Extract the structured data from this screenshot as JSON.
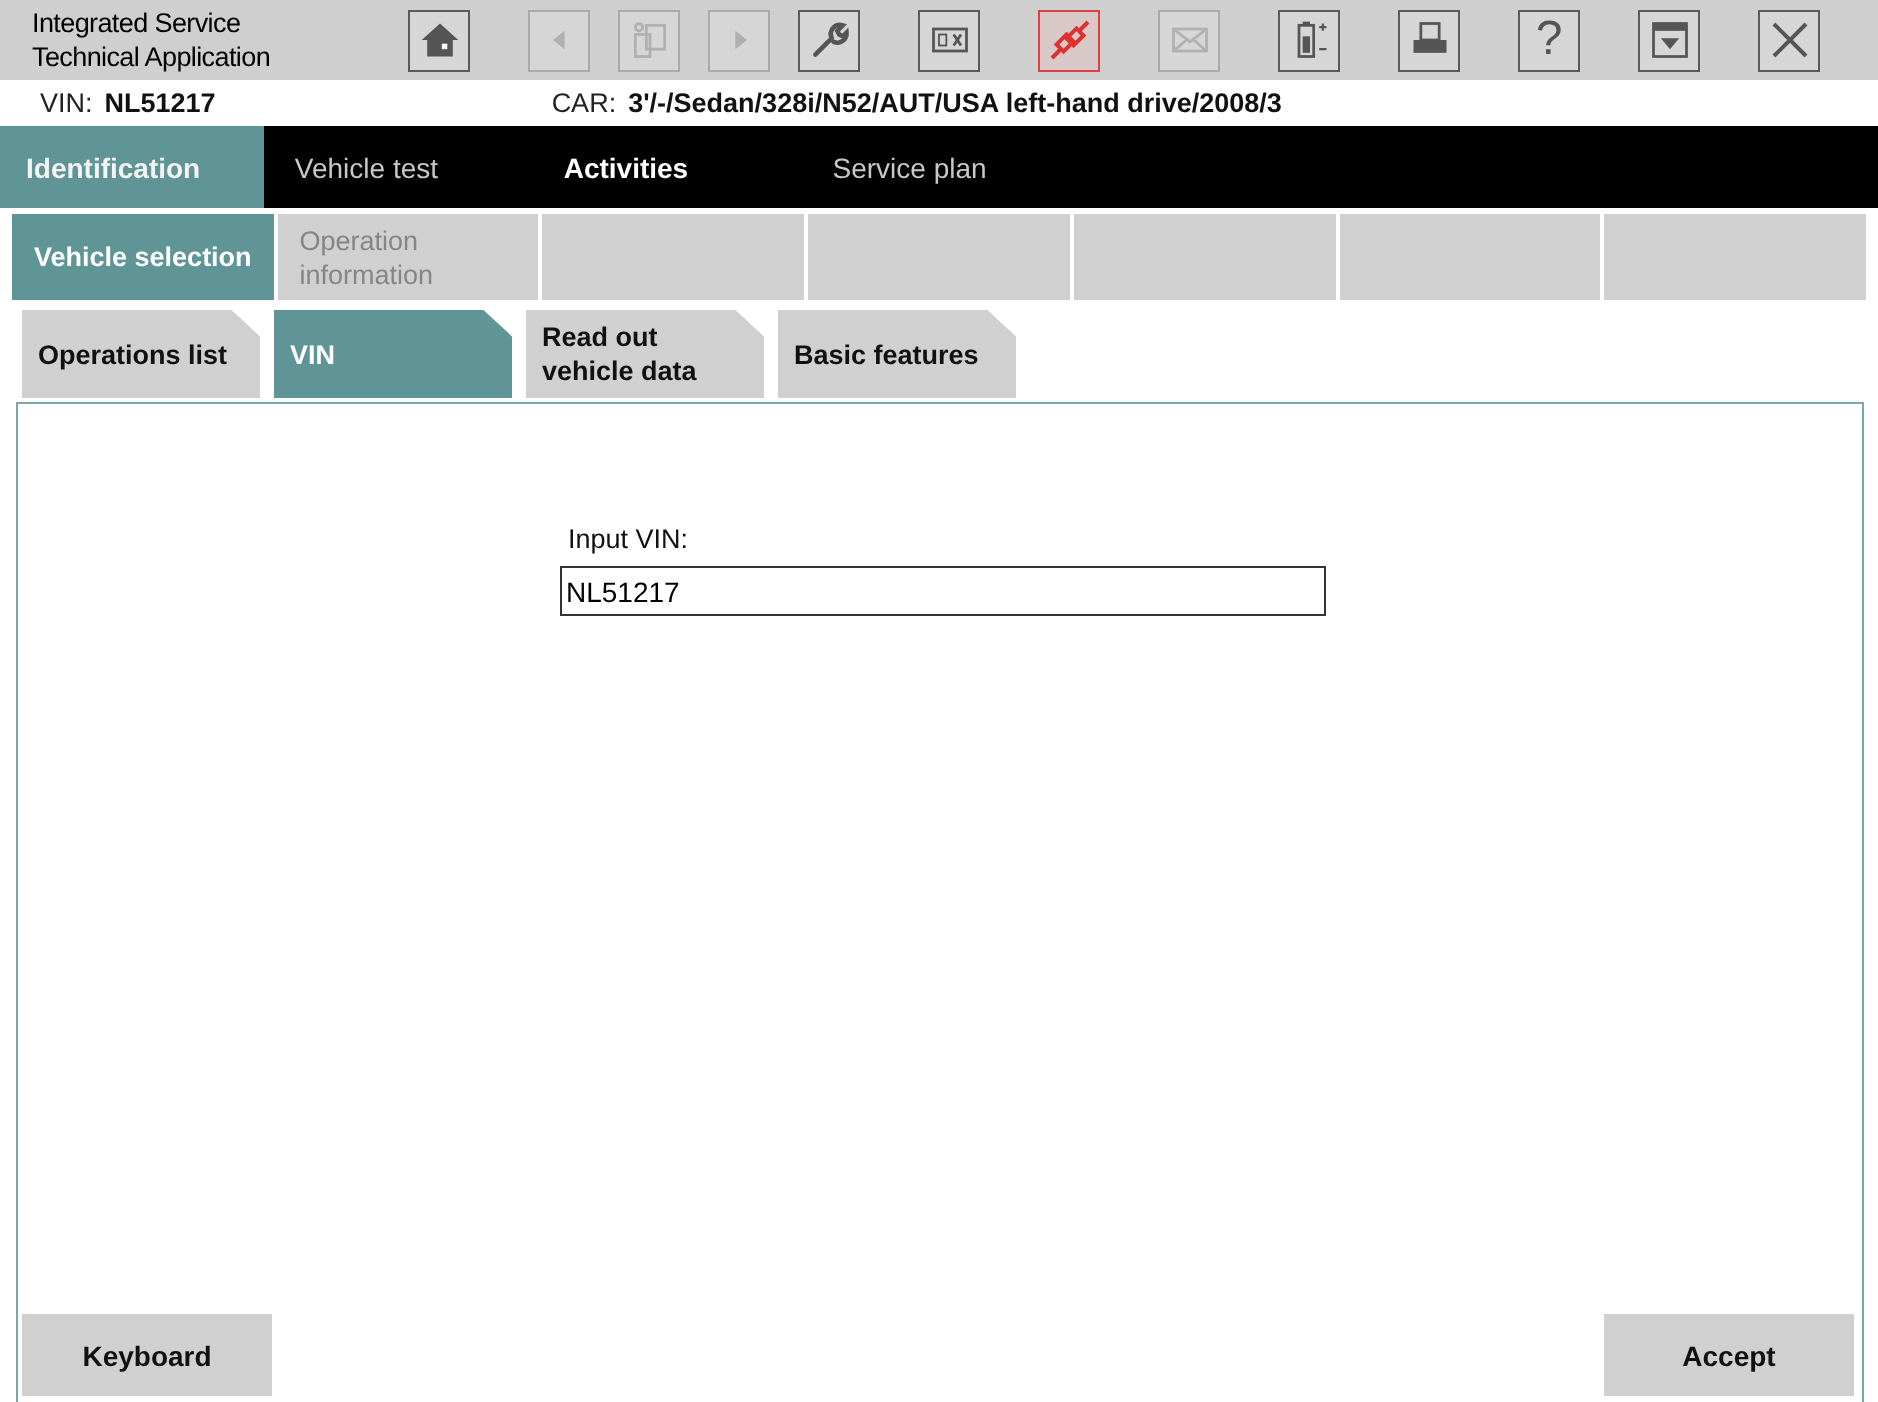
{
  "app_title": [
    "Integrated Service",
    "Technical Application"
  ],
  "toolbar": [
    {
      "kind": "home",
      "disabled": false,
      "active": false
    },
    {
      "kind": "back",
      "disabled": true,
      "active": false
    },
    {
      "kind": "copy",
      "disabled": true,
      "active": false
    },
    {
      "kind": "forward",
      "disabled": true,
      "active": false
    },
    {
      "kind": "wrench",
      "disabled": false,
      "active": false
    },
    {
      "kind": "toggle",
      "disabled": false,
      "active": false
    },
    {
      "kind": "connection",
      "disabled": false,
      "active": true
    },
    {
      "kind": "mail",
      "disabled": true,
      "active": false
    },
    {
      "kind": "battery",
      "disabled": false,
      "active": false
    },
    {
      "kind": "printer",
      "disabled": false,
      "active": false
    },
    {
      "kind": "help",
      "disabled": false,
      "active": false,
      "text": "?"
    },
    {
      "kind": "panel",
      "disabled": false,
      "active": false
    },
    {
      "kind": "close",
      "disabled": false,
      "active": false
    }
  ],
  "info": {
    "vin_label": "VIN:",
    "vin": "NL51217",
    "car_label": "CAR:",
    "car": "3'/-/Sedan/328i/N52/AUT/USA left-hand drive/2008/3"
  },
  "main_tabs": [
    {
      "label": "Identification",
      "selected": true,
      "dimmed": false
    },
    {
      "label": "Vehicle test",
      "selected": false,
      "dimmed": true
    },
    {
      "label": "Activities",
      "selected": false,
      "dimmed": false
    },
    {
      "label": "Service plan",
      "selected": false,
      "dimmed": true
    }
  ],
  "sub_tabs": [
    {
      "label": "Vehicle selection",
      "selected": true,
      "disabled": false
    },
    {
      "label": "Operation information",
      "selected": false,
      "disabled": true
    }
  ],
  "page_tabs": [
    {
      "label": "Operations list",
      "selected": false
    },
    {
      "label": "VIN",
      "selected": true
    },
    {
      "label": "Read out vehicle data",
      "selected": false
    },
    {
      "label": "Basic features",
      "selected": false
    }
  ],
  "form": {
    "label": "Input VIN:",
    "value": "NL51217"
  },
  "buttons": {
    "left": "Keyboard",
    "right": "Accept"
  }
}
